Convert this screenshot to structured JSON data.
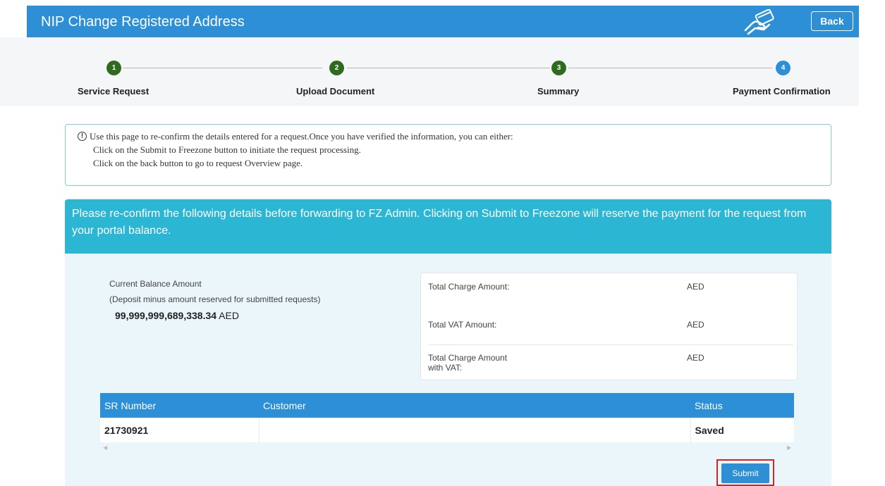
{
  "header": {
    "title": "NIP Change Registered Address",
    "back_label": "Back",
    "icon": "hand-card-icon"
  },
  "stepper": {
    "steps": [
      {
        "number": "1",
        "label": "Service Request",
        "state": "done"
      },
      {
        "number": "2",
        "label": "Upload Document",
        "state": "done"
      },
      {
        "number": "3",
        "label": "Summary",
        "state": "done"
      },
      {
        "number": "4",
        "label": "Payment Confirmation",
        "state": "active"
      }
    ]
  },
  "info": {
    "line1": "Use this page to re-confirm the details entered for a request.Once you have verified the information, you can either:",
    "line2": "Click on the Submit to Freezone button to initiate the request processing.",
    "line3": "Click on the back button to go to request Overview page."
  },
  "banner": {
    "text": "Please re-confirm the following details before forwarding to FZ Admin. Clicking on Submit to Freezone will reserve the payment for the request from your portal balance."
  },
  "balance": {
    "label": "Current Balance Amount",
    "sublabel": "(Deposit minus amount reserved for submitted requests)",
    "amount": "99,999,999,689,338.34",
    "currency": "AED"
  },
  "charges": {
    "total_charge_label": "Total Charge Amount:",
    "total_charge_value": "AED",
    "total_vat_label": "Total VAT Amount:",
    "total_vat_value": "AED",
    "total_with_vat_label_1": "Total Charge Amount",
    "total_with_vat_label_2": "with VAT:",
    "total_with_vat_value": "AED"
  },
  "table": {
    "columns": [
      "SR Number",
      "Customer",
      "Status"
    ],
    "rows": [
      {
        "sr_number": "21730921",
        "customer": "",
        "status": "Saved"
      }
    ]
  },
  "submit_label": "Submit",
  "colors": {
    "primary": "#2d8fd5",
    "banner": "#2bb7d4",
    "step_done": "#2e6b1f",
    "highlight": "#e02020"
  }
}
